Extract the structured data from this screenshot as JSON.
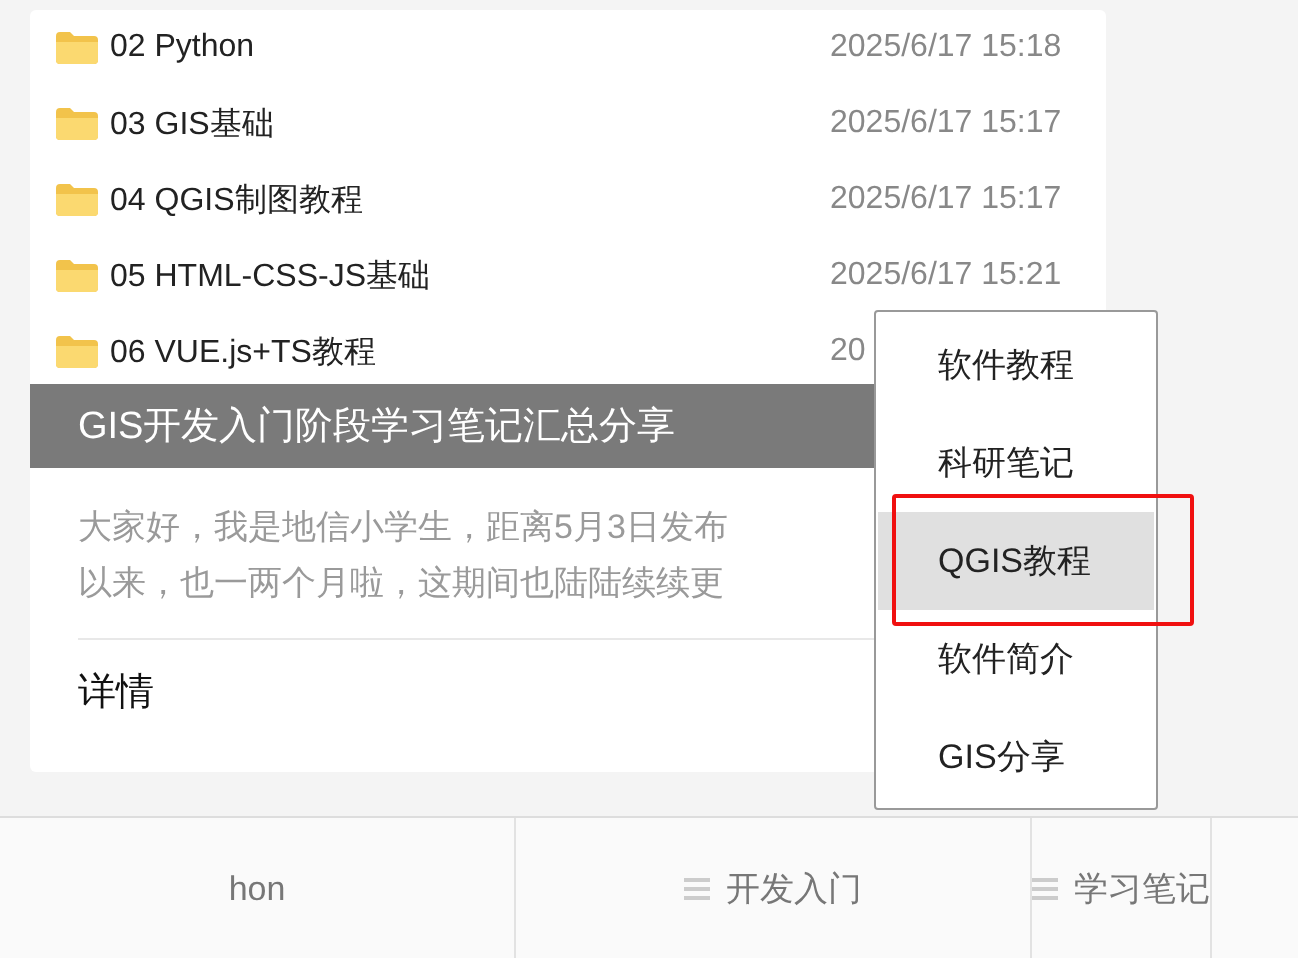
{
  "files": [
    {
      "name": "02 Python",
      "date": "2025/6/17 15:18"
    },
    {
      "name": "03 GIS基础",
      "date": "2025/6/17 15:17"
    },
    {
      "name": "04 QGIS制图教程",
      "date": "2025/6/17 15:17"
    },
    {
      "name": "05 HTML-CSS-JS基础",
      "date": "2025/6/17 15:21"
    },
    {
      "name": "06 VUE.js+TS教程",
      "date": "20"
    }
  ],
  "caption": "GIS开发入门阶段学习笔记汇总分享",
  "summary": [
    "大家好，我是地信小学生，距离5月3日发布",
    "以来，也一两个月啦，这期间也陆陆续续更"
  ],
  "details_link": "详情",
  "menu": [
    {
      "label": "软件教程",
      "selected": false
    },
    {
      "label": "科研笔记",
      "selected": false
    },
    {
      "label": "QGIS教程",
      "selected": true
    },
    {
      "label": "软件简介",
      "selected": false
    },
    {
      "label": "GIS分享",
      "selected": false
    }
  ],
  "tabs": [
    {
      "label": "hon",
      "icon": false
    },
    {
      "label": "开发入门",
      "icon": true
    },
    {
      "label": "学习笔记",
      "icon": true
    }
  ]
}
